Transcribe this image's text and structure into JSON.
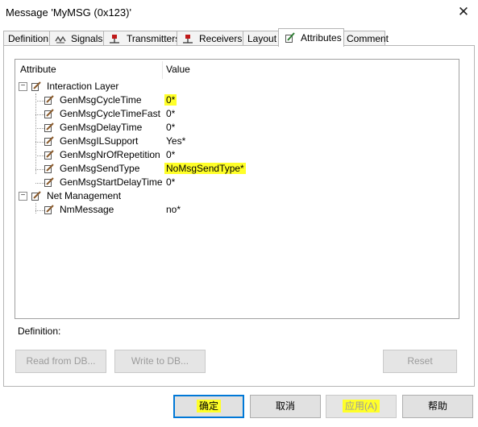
{
  "window": {
    "title": "Message 'MyMSG (0x123)'"
  },
  "tabs": [
    {
      "label": "Definition",
      "icon": "none"
    },
    {
      "label": "Signals",
      "icon": "signals-icon"
    },
    {
      "label": "Transmitters",
      "icon": "transmitter-icon"
    },
    {
      "label": "Receivers",
      "icon": "receiver-icon"
    },
    {
      "label": "Layout",
      "icon": "none"
    },
    {
      "label": "Attributes",
      "icon": "attribute-icon",
      "active": true
    },
    {
      "label": "Comment",
      "icon": "none"
    }
  ],
  "table": {
    "headers": {
      "attribute": "Attribute",
      "value": "Value"
    },
    "groups": [
      {
        "label": "Interaction Layer",
        "expander": "−",
        "items": [
          {
            "name": "GenMsgCycleTime",
            "value": "0*",
            "highlighted": true
          },
          {
            "name": "GenMsgCycleTimeFast",
            "value": "0*"
          },
          {
            "name": "GenMsgDelayTime",
            "value": "0*"
          },
          {
            "name": "GenMsgILSupport",
            "value": "Yes*"
          },
          {
            "name": "GenMsgNrOfRepetition",
            "value": "0*"
          },
          {
            "name": "GenMsgSendType",
            "value": "NoMsgSendType*",
            "highlighted": true
          },
          {
            "name": "GenMsgStartDelayTime",
            "value": "0*"
          }
        ]
      },
      {
        "label": "Net Management",
        "expander": "−",
        "items": [
          {
            "name": "NmMessage",
            "value": "no*"
          }
        ]
      }
    ]
  },
  "definition": {
    "label": "Definition:"
  },
  "buttons": {
    "read_from_db": "Read from DB...",
    "write_to_db": "Write to DB...",
    "reset": "Reset",
    "ok": "确定",
    "cancel": "取消",
    "apply": "应用(A)",
    "help": "帮助"
  },
  "colors": {
    "highlight": "#ffff28",
    "focus_border": "#0078d7",
    "disabled_text": "#9b9b9b"
  }
}
